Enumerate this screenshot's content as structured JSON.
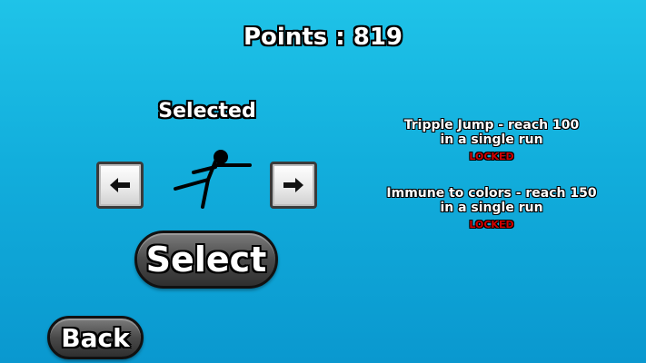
{
  "header": {
    "points_text": "Points : 819"
  },
  "selector": {
    "selected_label": "Selected",
    "left_arrow_icon": "arrow-left-icon",
    "right_arrow_icon": "arrow-right-icon",
    "character_icon": "stickman-runner-icon"
  },
  "buttons": {
    "select_label": "Select",
    "back_label": "Back"
  },
  "unlocks": [
    {
      "line1": "Tripple Jump - reach 100",
      "line2": "in a single run",
      "status": "LOCKED"
    },
    {
      "line1": "Immune to colors - reach 150",
      "line2": "in a single run",
      "status": "LOCKED"
    }
  ],
  "colors": {
    "background": "#12aedc",
    "locked": "#d40000"
  }
}
